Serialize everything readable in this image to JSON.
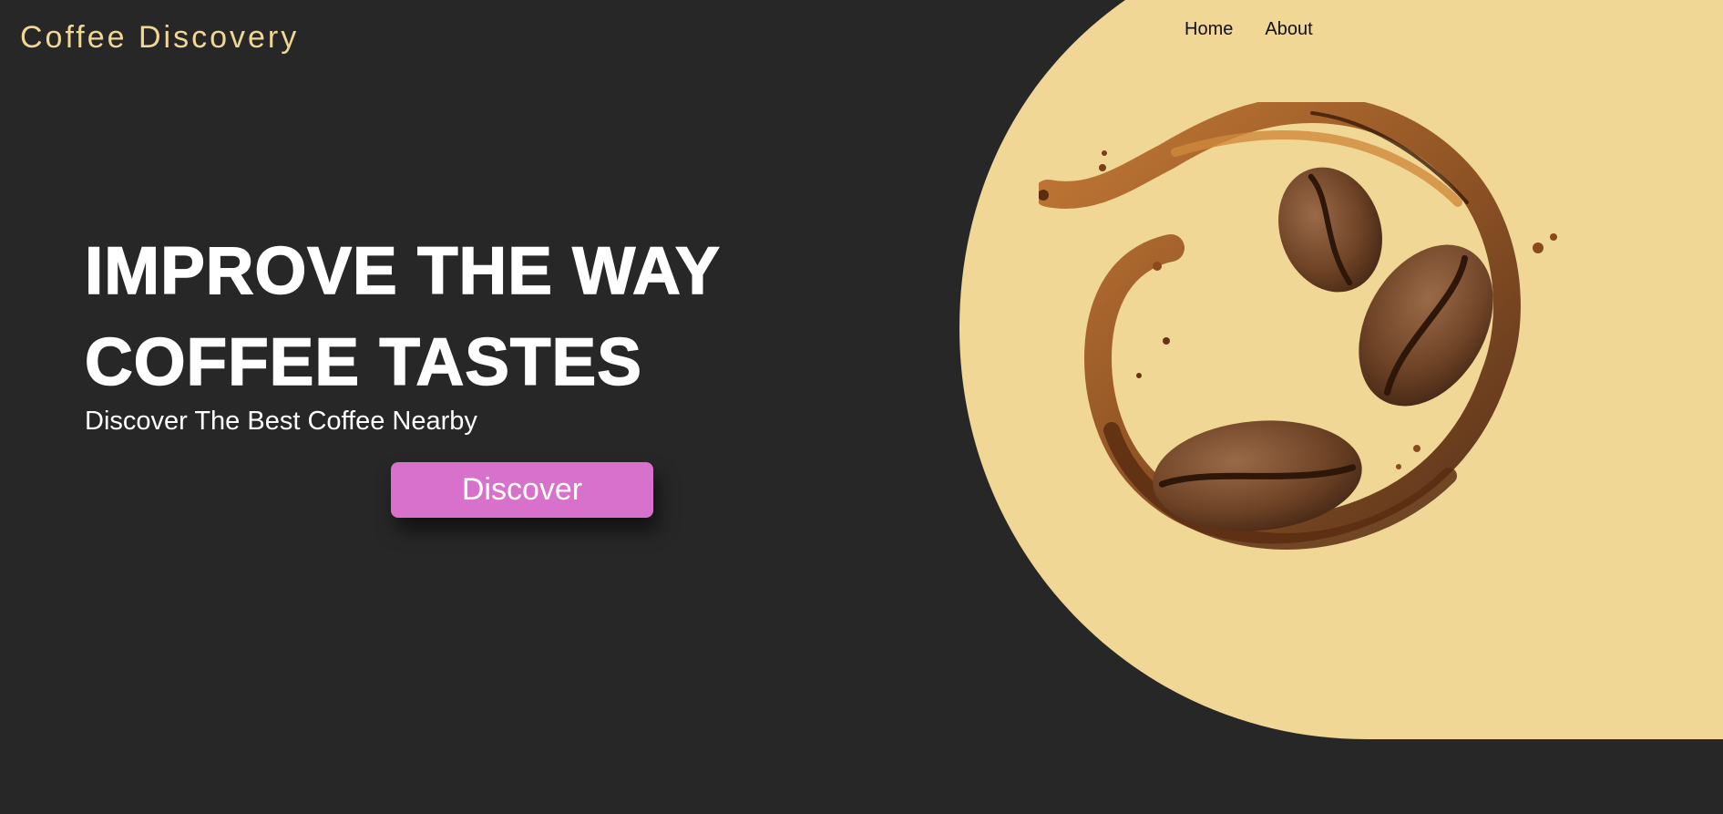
{
  "brand": {
    "logo_text": "Coffee Discovery"
  },
  "nav": {
    "items": [
      {
        "label": "Home"
      },
      {
        "label": "About"
      }
    ]
  },
  "hero": {
    "headline_line1": "IMPROVE THE WAY",
    "headline_line2": "COFFEE TASTES",
    "subheading": "Discover The Best Coffee Nearby",
    "cta_label": "Discover"
  },
  "colors": {
    "background": "#272727",
    "accent_cream": "#f0d795",
    "button": "#d771cb",
    "text_light": "#ffffff",
    "nav_text": "#111111"
  },
  "images": {
    "hero_image": "coffee-splash-with-beans"
  }
}
